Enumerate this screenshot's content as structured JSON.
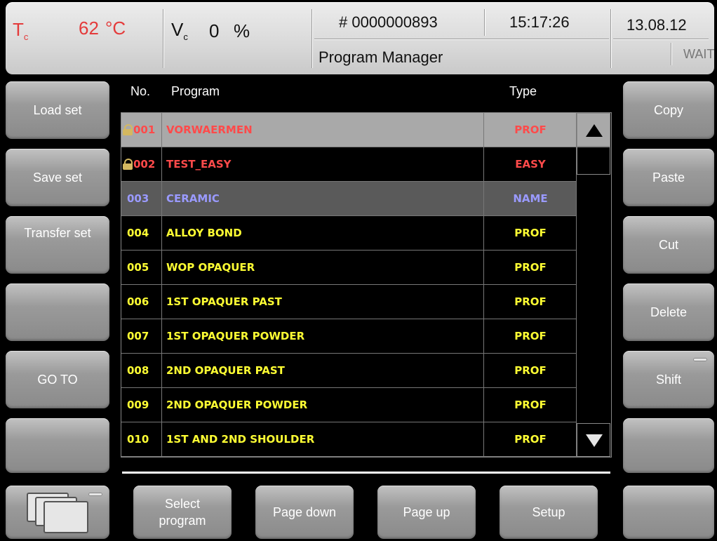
{
  "header": {
    "tc_label": "T",
    "tc_sub": "c",
    "tc_value": "62",
    "tc_unit": "°C",
    "vc_label": "V",
    "vc_sub": "c",
    "vc_value": "0",
    "vc_unit": "%",
    "program_number": "# 0000000893",
    "time": "15:17:26",
    "date": "13.08.12",
    "title": "Program Manager",
    "status": "WAIT"
  },
  "left_buttons": [
    "Load set",
    "Save set",
    "Transfer set",
    "",
    "GO TO",
    ""
  ],
  "right_buttons": [
    "Copy",
    "Paste",
    "Cut",
    "Delete",
    "Shift",
    ""
  ],
  "bottom_buttons": [
    "Select program",
    "Page down",
    "Page up",
    "Setup"
  ],
  "list": {
    "headers": {
      "no": "No.",
      "program": "Program",
      "type": "Type"
    },
    "rows": [
      {
        "no": "001",
        "name": "VORWAERMEN",
        "type": "PROF",
        "locked": true
      },
      {
        "no": "002",
        "name": "TEST_EASY",
        "type": "EASY",
        "locked": true
      },
      {
        "no": "003",
        "name": "CERAMIC",
        "type": "NAME",
        "locked": false
      },
      {
        "no": "004",
        "name": "ALLOY BOND",
        "type": "PROF",
        "locked": false
      },
      {
        "no": "005",
        "name": "WOP OPAQUER",
        "type": "PROF",
        "locked": false
      },
      {
        "no": "006",
        "name": "1ST OPAQUER PAST",
        "type": "PROF",
        "locked": false
      },
      {
        "no": "007",
        "name": "1ST OPAQUER POWDER",
        "type": "PROF",
        "locked": false
      },
      {
        "no": "008",
        "name": "2ND OPAQUER PAST",
        "type": "PROF",
        "locked": false
      },
      {
        "no": "009",
        "name": "2ND OPAQUER POWDER",
        "type": "PROF",
        "locked": false
      },
      {
        "no": "010",
        "name": "1ST AND 2ND SHOULDER",
        "type": "PROF",
        "locked": false
      }
    ]
  },
  "colors": {
    "locked_text": "#ff4a4a",
    "selected_text": "#9a9aff",
    "normal_text": "#ffff33",
    "selected_bg": "#5a5a5a",
    "highlight_bg": "#a9a9a9"
  },
  "icons": {
    "lock": "lock-icon",
    "scroll_up": "triangle-up-icon",
    "scroll_down": "triangle-down-icon",
    "windows": "multi-window-icon"
  }
}
